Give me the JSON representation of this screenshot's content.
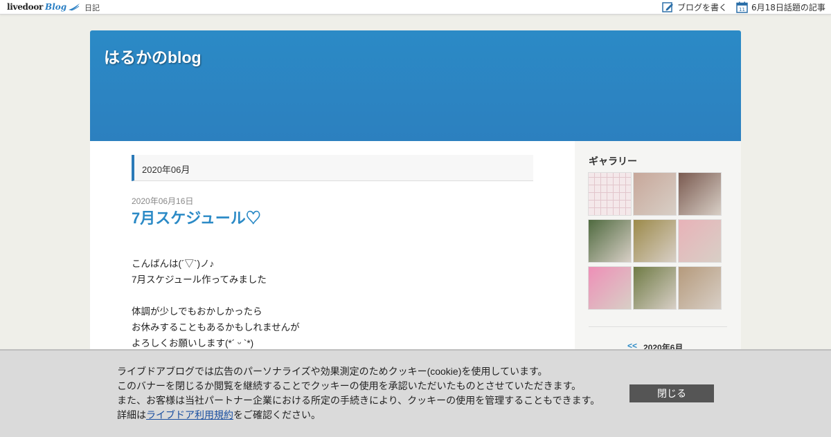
{
  "topbar": {
    "logo_text": "livedoor",
    "logo_blog": "Blog",
    "nav_diary": "日記",
    "write_label": "ブログを書く",
    "topic_label": "6月18日話題の記事",
    "calendar_day": "11"
  },
  "header": {
    "title": "はるかのblog"
  },
  "main": {
    "month_heading": "2020年06月",
    "post": {
      "date": "2020年06月16日",
      "title": "7月スケジュール♡",
      "lines": [
        "こんばんは(´▽`)ノ♪",
        "7月スケジュール作ってみました",
        "",
        "体調が少しでもおかしかったら",
        "お休みすることもあるかもしれませんが",
        "よろしくお願いします(*´ ᵕ `*)"
      ]
    }
  },
  "sidebar": {
    "gallery_title": "ギャラリー",
    "thumbnails": [
      {
        "kind": "schedule",
        "color": "#f4e8ea"
      },
      {
        "kind": "photo",
        "color": "#c7a79a"
      },
      {
        "kind": "photo",
        "color": "#7a5a50"
      },
      {
        "kind": "photo",
        "color": "#4f6a3f"
      },
      {
        "kind": "photo",
        "color": "#9c8a4a"
      },
      {
        "kind": "photo",
        "color": "#e8b2b8"
      },
      {
        "kind": "photo",
        "color": "#ee8fb7"
      },
      {
        "kind": "photo",
        "color": "#6f7b45"
      },
      {
        "kind": "photo",
        "color": "#b59a7c"
      }
    ],
    "calendar": {
      "prev": "<<",
      "month": "2020年6月"
    }
  },
  "cookie": {
    "line1": "ライブドアブログでは広告のパーソナライズや効果測定のためクッキー(cookie)を使用しています。",
    "line2": "このバナーを閉じるか閲覧を継続することでクッキーの使用を承認いただいたものとさせていただきます。",
    "line3": "また、お客様は当社パートナー企業における所定の手続きにより、クッキーの使用を管理することもできます。",
    "line4_prefix": "詳細は",
    "line4_link": "ライブドア利用規約",
    "line4_suffix": "をご確認ください。",
    "close_label": "閉じる"
  },
  "colors": {
    "accent": "#2b8ac6",
    "header_bg": "#2c80bf",
    "page_bg": "#efefe9",
    "banner_bg": "#dadada",
    "button_bg": "#555555"
  }
}
